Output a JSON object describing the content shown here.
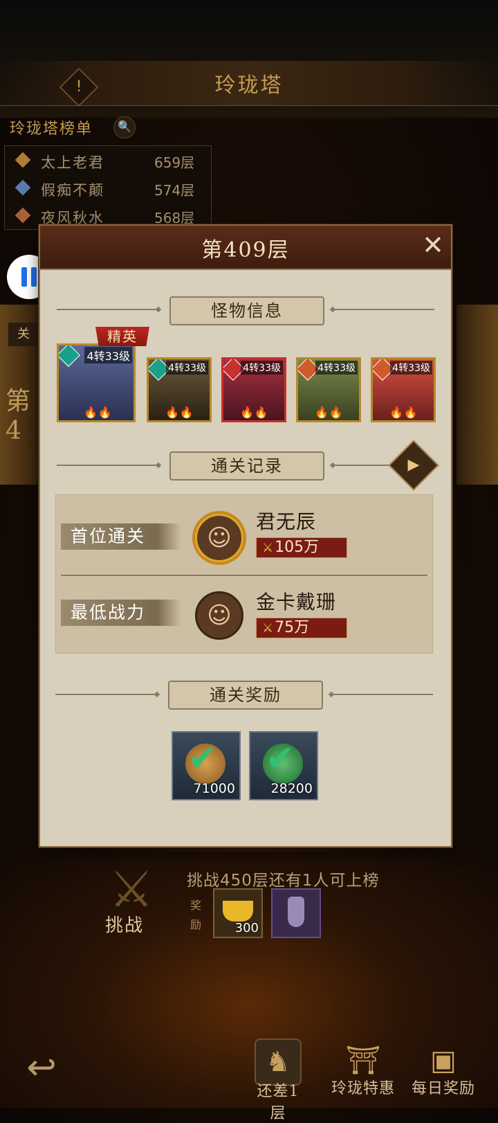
{
  "header": {
    "title": "玲珑塔",
    "alert_icon": "!"
  },
  "leaderboard": {
    "title": "玲珑塔榜单",
    "search_icon": "🔍",
    "entries": [
      {
        "rank": "1",
        "name": "太上老君",
        "floor": "659层",
        "color": "#b07a3a"
      },
      {
        "rank": "2",
        "name": "假痴不颠",
        "floor": "574层",
        "color": "#5a7aa8"
      },
      {
        "rank": "3",
        "name": "夜风秋水",
        "floor": "568层",
        "color": "#a8603a"
      }
    ]
  },
  "background": {
    "side_tag": "关",
    "side_floor_char": "第4"
  },
  "overlay": {
    "pause_icon": "pause",
    "fast_forward_icon": "»"
  },
  "modal": {
    "title": "第409层",
    "close_icon": "✕",
    "monster_section": "怪物信息",
    "elite_tag": "精英",
    "monsters": [
      {
        "level": "4转33级",
        "stars": "🔥🔥"
      },
      {
        "level": "4转33级",
        "stars": "🔥🔥"
      },
      {
        "level": "4转33级",
        "stars": "🔥🔥"
      },
      {
        "level": "4转33级",
        "stars": "🔥🔥"
      },
      {
        "level": "4转33级",
        "stars": "🔥🔥"
      }
    ],
    "record_section": "通关记录",
    "video_icon": "▶",
    "first_clear": {
      "label": "首位通关",
      "name": "君无辰",
      "power": "105万"
    },
    "lowest_power": {
      "label": "最低战力",
      "name": "金卡戴珊",
      "power": "75万"
    },
    "reward_section": "通关奖励",
    "rewards": [
      {
        "amount": "71000",
        "claimed_icon": "✔"
      },
      {
        "amount": "28200",
        "claimed_icon": "✔"
      }
    ]
  },
  "bottom": {
    "challenge_label": "挑战",
    "challenge_info": "挑战450层还有1人可上榜",
    "reward_tag": "奖励",
    "rewards": [
      {
        "amount": "300"
      },
      {
        "amount": ""
      }
    ],
    "nav": [
      {
        "label": "还差1层"
      },
      {
        "label": "玲珑特惠"
      },
      {
        "label": "每日奖励"
      }
    ]
  },
  "colors": {
    "accent_gold": "#c69a54",
    "modal_bg": "#d9cfbd",
    "header_brown": "#5a2c18",
    "power_red": "#7a1c14"
  }
}
